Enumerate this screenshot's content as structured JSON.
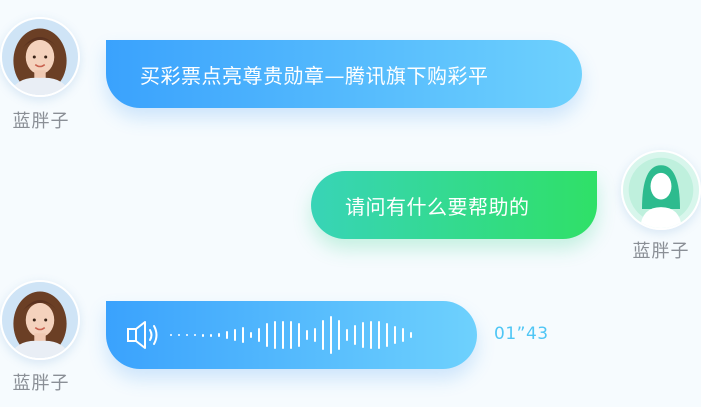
{
  "messages": [
    {
      "sender_name": "蓝胖子",
      "side": "left",
      "type": "text",
      "text": "买彩票点亮尊贵勋章—腾讯旗下购彩平"
    },
    {
      "sender_name": "蓝胖子",
      "side": "right",
      "type": "text",
      "text": "请问有什么要帮助的"
    },
    {
      "sender_name": "蓝胖子",
      "side": "left",
      "type": "voice",
      "duration": "01”43"
    }
  ],
  "icons": {
    "speaker": "speaker-icon",
    "avatar_photo": "user-photo-avatar",
    "avatar_placeholder": "person-silhouette-avatar"
  },
  "colors": {
    "blue_start": "#3aa2fd",
    "blue_end": "#6ed1fd",
    "green_start": "#38d4b7",
    "green_end": "#2fe067",
    "name_text": "#8a8f96",
    "duration_text": "#4fc6f5",
    "background": "#f6fbfe"
  }
}
